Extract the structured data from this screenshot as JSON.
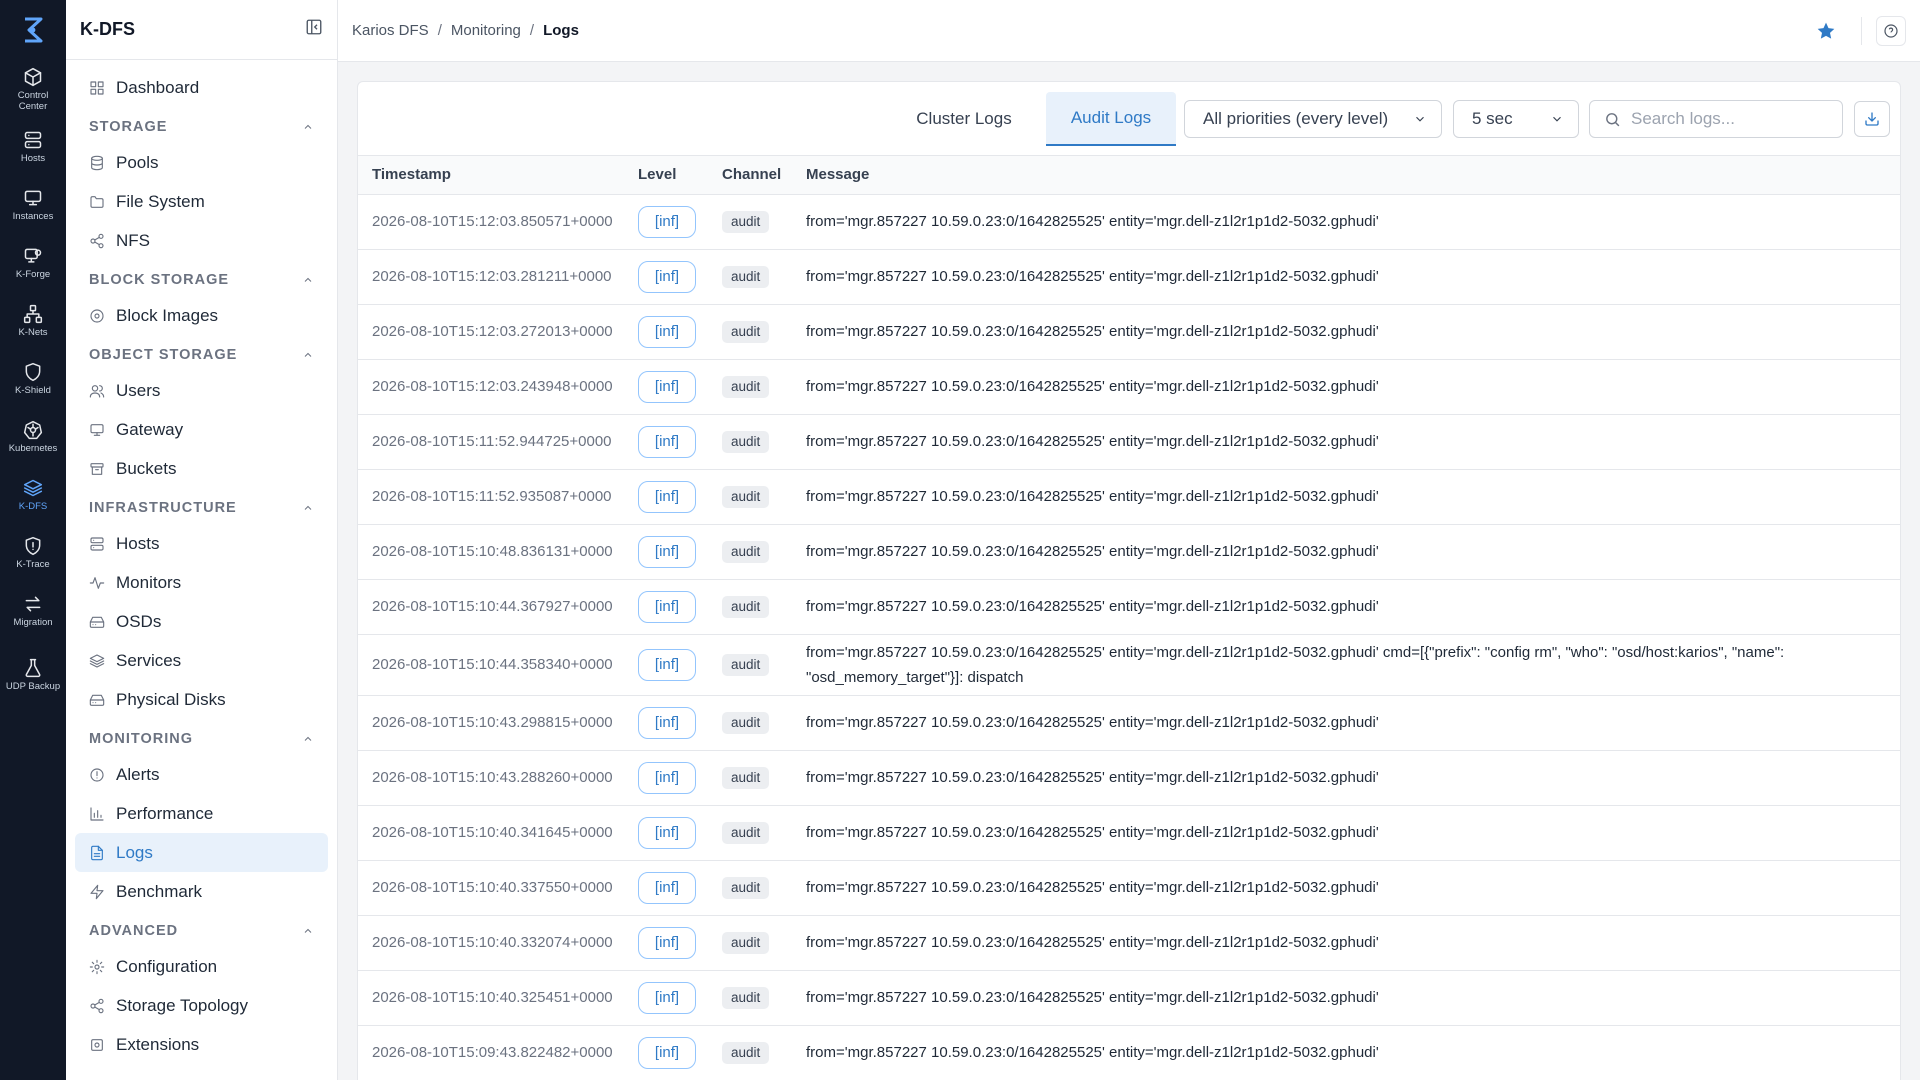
{
  "rail": {
    "items": [
      {
        "label": "Control Center",
        "icon": "cube-icon"
      },
      {
        "label": "Hosts",
        "icon": "server-icon"
      },
      {
        "label": "Instances",
        "icon": "monitor-icon"
      },
      {
        "label": "K-Forge",
        "icon": "forge-icon"
      },
      {
        "label": "K-Nets",
        "icon": "network-icon"
      },
      {
        "label": "K-Shield",
        "icon": "shield-icon"
      },
      {
        "label": "Kubernetes",
        "icon": "kubernetes-icon"
      },
      {
        "label": "K-DFS",
        "icon": "layers-icon",
        "active": true
      },
      {
        "label": "K-Trace",
        "icon": "trace-shield-icon"
      },
      {
        "label": "Migration",
        "icon": "arrows-icon"
      },
      {
        "label": "UDP Backup",
        "icon": "flask-icon"
      }
    ]
  },
  "sidebar": {
    "title": "K-DFS",
    "dashboard": "Dashboard",
    "sections": {
      "storage": {
        "title": "STORAGE",
        "items": [
          "Pools",
          "File System",
          "NFS"
        ]
      },
      "block": {
        "title": "BLOCK STORAGE",
        "items": [
          "Block Images"
        ]
      },
      "object": {
        "title": "OBJECT STORAGE",
        "items": [
          "Users",
          "Gateway",
          "Buckets"
        ]
      },
      "infra": {
        "title": "INFRASTRUCTURE",
        "items": [
          "Hosts",
          "Monitors",
          "OSDs",
          "Services",
          "Physical Disks"
        ]
      },
      "monitoring": {
        "title": "MONITORING",
        "items": [
          "Alerts",
          "Performance",
          "Logs",
          "Benchmark"
        ]
      },
      "advanced": {
        "title": "ADVANCED",
        "items": [
          "Configuration",
          "Storage Topology",
          "Extensions"
        ]
      }
    }
  },
  "breadcrumb": [
    "Karios DFS",
    "Monitoring",
    "Logs"
  ],
  "toolbar": {
    "tab_cluster": "Cluster Logs",
    "tab_audit": "Audit Logs",
    "priority": "All priorities (every level)",
    "interval": "5 sec",
    "search_placeholder": "Search logs..."
  },
  "table": {
    "headers": [
      "Timestamp",
      "Level",
      "Channel",
      "Message"
    ],
    "rows": [
      {
        "ts": "2026-08-10T15:12:03.850571+0000",
        "level": "[inf]",
        "channel": "audit",
        "msg": "from='mgr.857227 10.59.0.23:0/1642825525' entity='mgr.dell-z1l2r1p1d2-5032.gphudi'"
      },
      {
        "ts": "2026-08-10T15:12:03.281211+0000",
        "level": "[inf]",
        "channel": "audit",
        "msg": "from='mgr.857227 10.59.0.23:0/1642825525' entity='mgr.dell-z1l2r1p1d2-5032.gphudi'"
      },
      {
        "ts": "2026-08-10T15:12:03.272013+0000",
        "level": "[inf]",
        "channel": "audit",
        "msg": "from='mgr.857227 10.59.0.23:0/1642825525' entity='mgr.dell-z1l2r1p1d2-5032.gphudi'"
      },
      {
        "ts": "2026-08-10T15:12:03.243948+0000",
        "level": "[inf]",
        "channel": "audit",
        "msg": "from='mgr.857227 10.59.0.23:0/1642825525' entity='mgr.dell-z1l2r1p1d2-5032.gphudi'"
      },
      {
        "ts": "2026-08-10T15:11:52.944725+0000",
        "level": "[inf]",
        "channel": "audit",
        "msg": "from='mgr.857227 10.59.0.23:0/1642825525' entity='mgr.dell-z1l2r1p1d2-5032.gphudi'"
      },
      {
        "ts": "2026-08-10T15:11:52.935087+0000",
        "level": "[inf]",
        "channel": "audit",
        "msg": "from='mgr.857227 10.59.0.23:0/1642825525' entity='mgr.dell-z1l2r1p1d2-5032.gphudi'"
      },
      {
        "ts": "2026-08-10T15:10:48.836131+0000",
        "level": "[inf]",
        "channel": "audit",
        "msg": "from='mgr.857227 10.59.0.23:0/1642825525' entity='mgr.dell-z1l2r1p1d2-5032.gphudi'"
      },
      {
        "ts": "2026-08-10T15:10:44.367927+0000",
        "level": "[inf]",
        "channel": "audit",
        "msg": "from='mgr.857227 10.59.0.23:0/1642825525' entity='mgr.dell-z1l2r1p1d2-5032.gphudi'"
      },
      {
        "ts": "2026-08-10T15:10:44.358340+0000",
        "level": "[inf]",
        "channel": "audit",
        "msg": "from='mgr.857227 10.59.0.23:0/1642825525' entity='mgr.dell-z1l2r1p1d2-5032.gphudi' cmd=[{\"prefix\": \"config rm\", \"who\": \"osd/host:karios\", \"name\": \"osd_memory_target\"}]: dispatch"
      },
      {
        "ts": "2026-08-10T15:10:43.298815+0000",
        "level": "[inf]",
        "channel": "audit",
        "msg": "from='mgr.857227 10.59.0.23:0/1642825525' entity='mgr.dell-z1l2r1p1d2-5032.gphudi'"
      },
      {
        "ts": "2026-08-10T15:10:43.288260+0000",
        "level": "[inf]",
        "channel": "audit",
        "msg": "from='mgr.857227 10.59.0.23:0/1642825525' entity='mgr.dell-z1l2r1p1d2-5032.gphudi'"
      },
      {
        "ts": "2026-08-10T15:10:40.341645+0000",
        "level": "[inf]",
        "channel": "audit",
        "msg": "from='mgr.857227 10.59.0.23:0/1642825525' entity='mgr.dell-z1l2r1p1d2-5032.gphudi'"
      },
      {
        "ts": "2026-08-10T15:10:40.337550+0000",
        "level": "[inf]",
        "channel": "audit",
        "msg": "from='mgr.857227 10.59.0.23:0/1642825525' entity='mgr.dell-z1l2r1p1d2-5032.gphudi'"
      },
      {
        "ts": "2026-08-10T15:10:40.332074+0000",
        "level": "[inf]",
        "channel": "audit",
        "msg": "from='mgr.857227 10.59.0.23:0/1642825525' entity='mgr.dell-z1l2r1p1d2-5032.gphudi'"
      },
      {
        "ts": "2026-08-10T15:10:40.325451+0000",
        "level": "[inf]",
        "channel": "audit",
        "msg": "from='mgr.857227 10.59.0.23:0/1642825525' entity='mgr.dell-z1l2r1p1d2-5032.gphudi'"
      },
      {
        "ts": "2026-08-10T15:09:43.822482+0000",
        "level": "[inf]",
        "channel": "audit",
        "msg": "from='mgr.857227 10.59.0.23:0/1642825525' entity='mgr.dell-z1l2r1p1d2-5032.gphudi'"
      }
    ]
  },
  "colors": {
    "accent": "#2f7ac6",
    "rail_bg": "#111827",
    "active_bg": "#e8f1fb"
  }
}
